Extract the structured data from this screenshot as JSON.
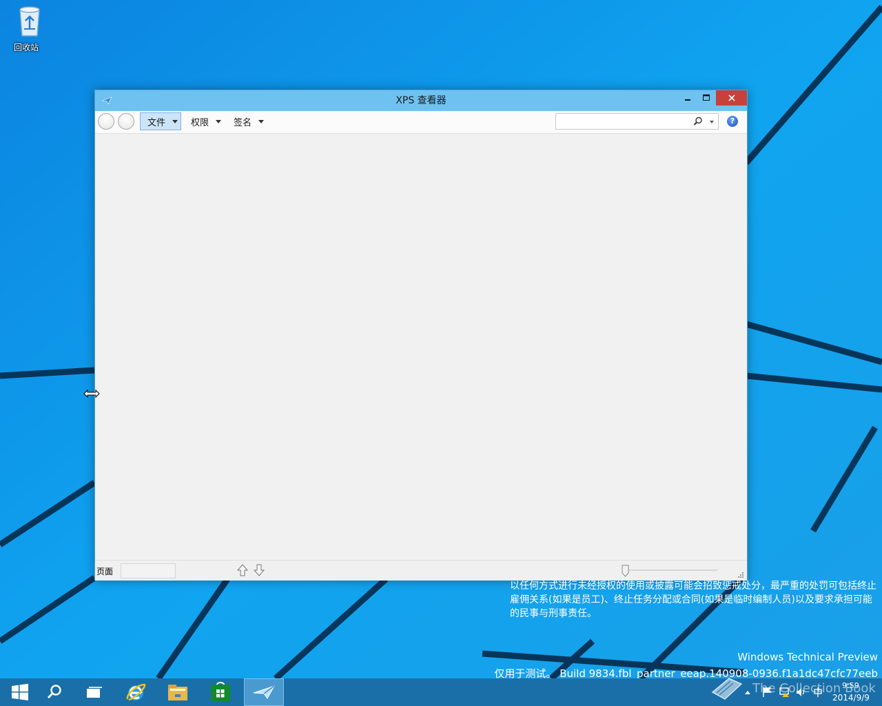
{
  "desktop": {
    "recycle_bin_label": "回收站",
    "warning_text": "以任何方式进行未经授权的使用或披露可能会招致惩戒处分，最严重的处罚可包括终止雇佣关系(如果是员工)、终止任务分配或合同(如果是临时编制人员)以及要求承担可能的民事与刑事责任。",
    "build_line1": "Windows Technical Preview",
    "build_line2": "仅用于测试。 Build 9834.fbl_partner_eeap.140908-0936.f1a1dc47cfc77eeb"
  },
  "window": {
    "title": "XPS 查看器",
    "menus": [
      {
        "label": "文件"
      },
      {
        "label": "权限"
      },
      {
        "label": "签名"
      }
    ],
    "search": {
      "value": "",
      "placeholder": ""
    },
    "help_label": "?",
    "status": {
      "page_label": "页面",
      "page_value": ""
    }
  },
  "taskbar": {
    "tray_watermark": "The Collection Book",
    "time": "9:59",
    "date": "2014/9/9"
  },
  "colors": {
    "desktop_blue": "#0ea3ef",
    "titlebar": "#6ec2f0",
    "close_red": "#c7413a",
    "taskbar": "#1a6fa8"
  }
}
